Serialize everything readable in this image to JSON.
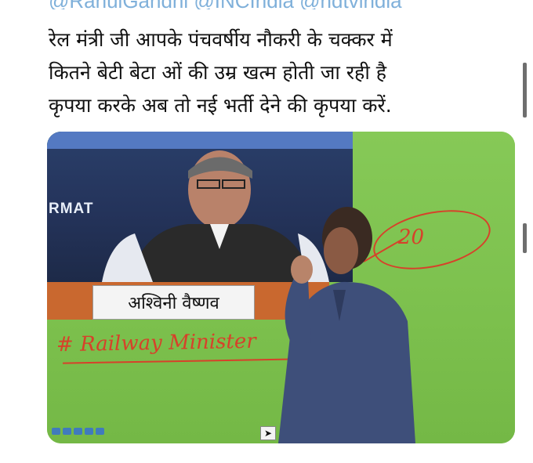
{
  "tweet": {
    "mentions": "@RahulGandhi @INCIndia @ndtvindia",
    "lines": [
      "रेल मंत्री जी आपके पंचवर्षीय नौकरी के चक्कर में",
      "कितने बेटी बेटा ओं की उम्र खत्म होती जा रही है",
      "कृपया करके अब तो नई भर्ती देने की कृपया करें."
    ]
  },
  "media": {
    "screen_text": "RMAT",
    "caption": "अश्विनी वैष्णव",
    "hashtag": "# Railway Minister",
    "annotation": "20"
  },
  "colors": {
    "board_green": "#7cc04d",
    "marker_red": "#d7412a",
    "mention_blue": "#7fb0da"
  },
  "icons": {
    "toolbar": [
      "pen-icon",
      "marker-icon",
      "cursor-icon",
      "eraser-icon",
      "zoom-icon"
    ],
    "pointer": "arrow-cursor-icon"
  }
}
